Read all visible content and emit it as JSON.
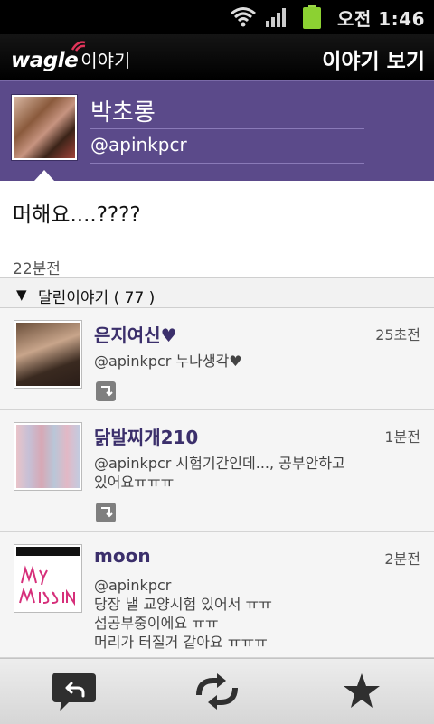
{
  "status_bar": {
    "time": "오전 1:46",
    "icons": [
      "wifi-icon",
      "signal-icon",
      "battery-icon"
    ]
  },
  "app_bar": {
    "logo_brand": "wagle",
    "logo_sub": "이야기",
    "title": "이야기 보기"
  },
  "profile": {
    "name": "박초롱",
    "handle": "@apinkpcr"
  },
  "message": {
    "text": "머해요....????",
    "time": "22분전"
  },
  "replies": {
    "header": "달린이야기 ( 77 )",
    "items": [
      {
        "name": "은지여신♥",
        "time": "25초전",
        "lines": [
          "@apinkpcr 누나생각♥"
        ]
      },
      {
        "name": "닭발찌개210",
        "time": "1분전",
        "lines": [
          "@apinkpcr 시험기간인데..., 공부안하고",
          "있어요ㅠㅠㅠ"
        ]
      },
      {
        "name": "moon",
        "time": "2분전",
        "lines": [
          "@apinkpcr",
          "당장 낼 교양시험 있어서 ㅠㅠ",
          "섬공부중이에요 ㅠㅠ",
          "머리가 터질거 같아요 ㅠㅠㅠ"
        ]
      }
    ]
  },
  "bottom_bar": {
    "buttons": [
      "reply-icon",
      "retweet-icon",
      "star-icon"
    ]
  },
  "colors": {
    "profile_bg": "#5b4a8a",
    "name_color": "#3b2f6b"
  }
}
